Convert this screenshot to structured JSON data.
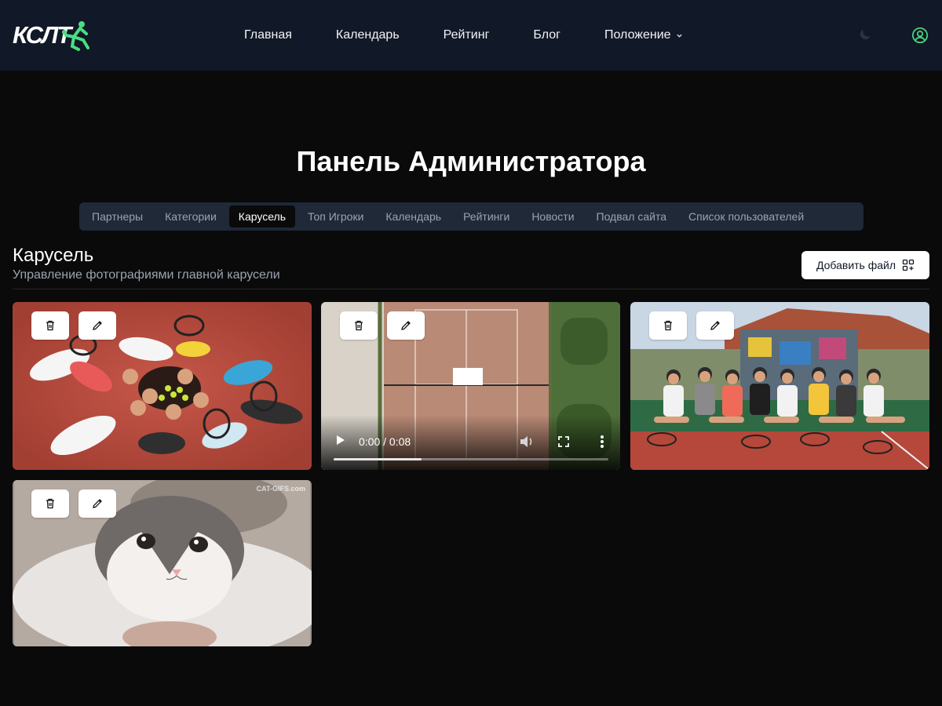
{
  "header": {
    "logo_text": "КСЛТ",
    "nav": [
      {
        "label": "Главная"
      },
      {
        "label": "Календарь"
      },
      {
        "label": "Рейтинг"
      },
      {
        "label": "Блог"
      },
      {
        "label": "Положение"
      }
    ],
    "accent_color": "#4ade80"
  },
  "page_title": "Панель Администратора",
  "tabs": [
    {
      "label": "Партнеры"
    },
    {
      "label": "Категории"
    },
    {
      "label": "Карусель",
      "active": true
    },
    {
      "label": "Топ Игроки"
    },
    {
      "label": "Календарь"
    },
    {
      "label": "Рейтинги"
    },
    {
      "label": "Новости"
    },
    {
      "label": "Подвал сайта"
    },
    {
      "label": "Список пользователей"
    }
  ],
  "section": {
    "title": "Карусель",
    "subtitle": "Управление фотографиями главной карусели",
    "add_button": "Добавить файл"
  },
  "media": [
    {
      "type": "image",
      "subject": "players lying on court"
    },
    {
      "type": "video",
      "time": "0:00 / 0:08",
      "progress": 0.32
    },
    {
      "type": "image",
      "subject": "group photo on court"
    },
    {
      "type": "image",
      "subject": "cat",
      "watermark": "CAT-GIFS.com"
    }
  ]
}
